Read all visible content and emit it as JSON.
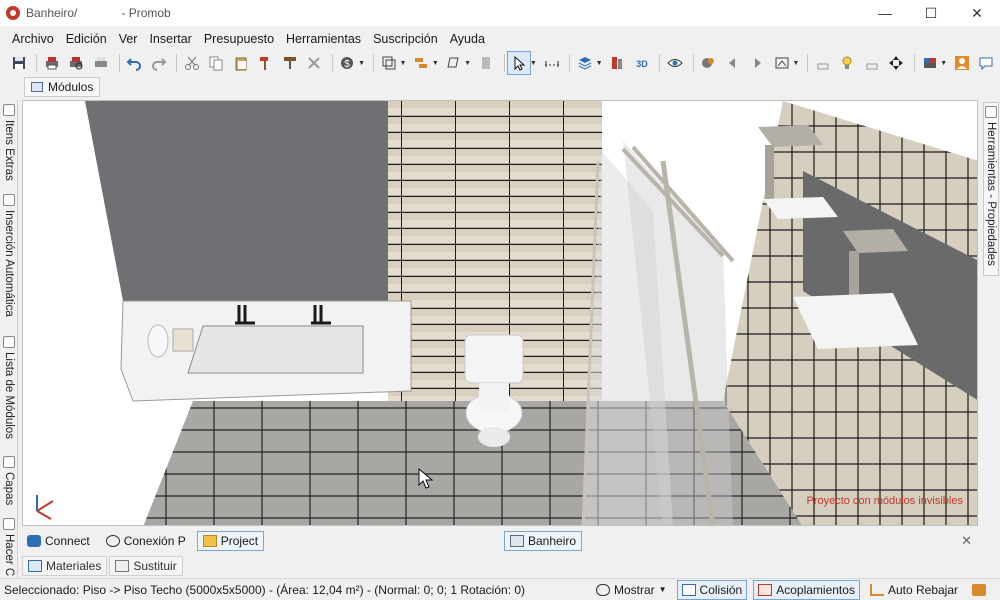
{
  "window": {
    "title_project": "Banheiro/",
    "title_app": "- Promob",
    "minimize_glyph": "—",
    "maximize_glyph": "☐",
    "close_glyph": "✕"
  },
  "menu": [
    "Archivo",
    "Edición",
    "Ver",
    "Insertar",
    "Presupuesto",
    "Herramientas",
    "Suscripción",
    "Ayuda"
  ],
  "toolbar_icons": [
    "save-icon",
    "print-icon",
    "undo-icon",
    "redo-icon",
    "cut-icon",
    "copy-icon",
    "paste-icon",
    "delete-icon",
    "budget-icon",
    "select-icon",
    "eye-icon",
    "light-bulb-icon"
  ],
  "modules_tab": {
    "label": "Módulos"
  },
  "left_dock": [
    {
      "label": "Itens Extras"
    },
    {
      "label": "Inserción Automática"
    },
    {
      "label": "Lista de Módulos"
    },
    {
      "label": "Capas"
    },
    {
      "label": "Hacer C"
    }
  ],
  "right_dock": {
    "label": "Herramientas - Propiedades"
  },
  "viewport": {
    "watermark": "Proyecto con módulos invisibles",
    "watermark_color": "#c0392b"
  },
  "bottom_tabs": [
    {
      "label": "Connect"
    },
    {
      "label": "Conexión P"
    },
    {
      "label": "Project"
    }
  ],
  "document_tab": {
    "label": "Banheiro",
    "close_glyph": "✕"
  },
  "material_tabs": [
    {
      "label": "Materiales"
    },
    {
      "label": "Sustituir"
    }
  ],
  "status": {
    "selection": "Seleccionado: Piso -> Piso Techo (5000x5x5000) - (Área: 12,04 m²) - (Normal: 0; 0; 1 Rotación: 0)",
    "mostrar": "Mostrar",
    "colision": "Colisión",
    "acoplamientos": "Acoplamientos",
    "auto_rebajar": "Auto Rebajar"
  },
  "colors": {
    "accent": "#2f6db5",
    "wall_dark": "#6e7073",
    "tile_light": "#e4dccf",
    "floor": "#a9a7a3"
  }
}
